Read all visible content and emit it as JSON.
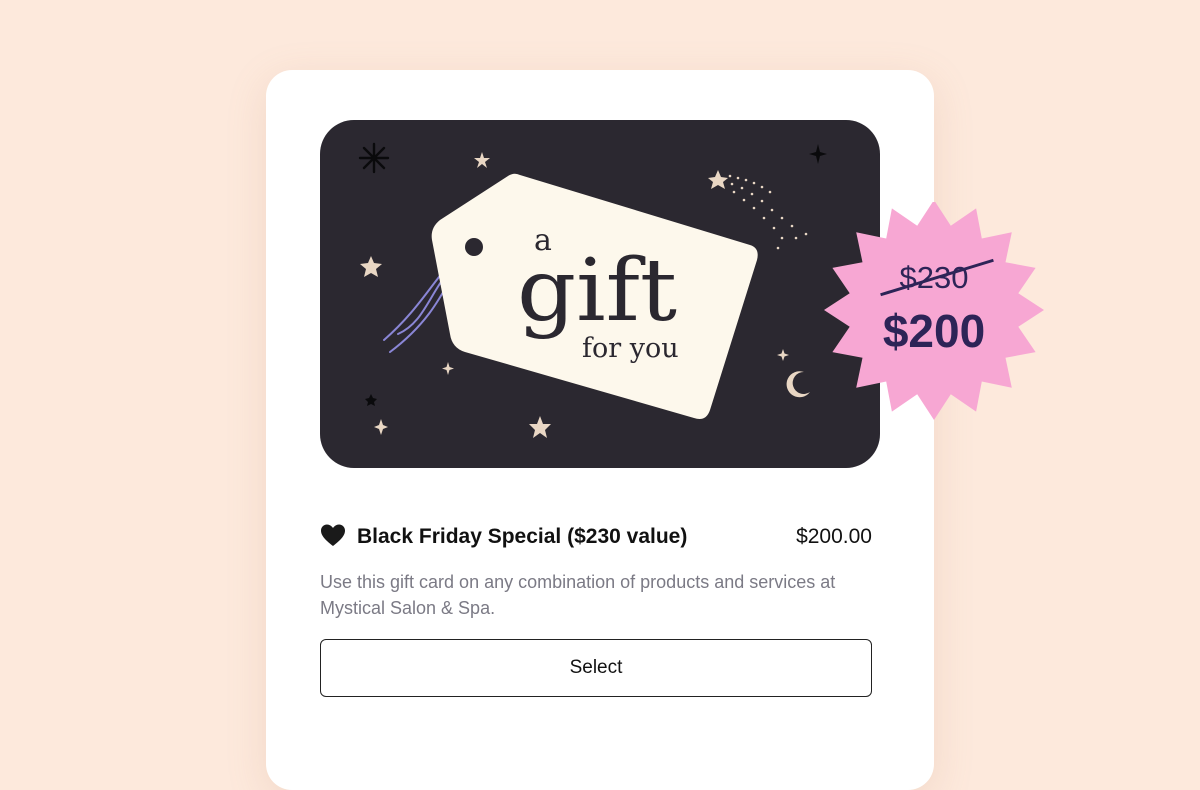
{
  "gift_card": {
    "art_text": {
      "line1": "a",
      "line2": "gift",
      "line3": "for you"
    },
    "colors": {
      "card_background": "#2b2830",
      "tag": "#fdf8ec",
      "stars": "#e9d7c4",
      "ribbon": "#8a86d6"
    }
  },
  "badge": {
    "old_price": "$230",
    "new_price": "$200",
    "colors": {
      "background": "#f7a7d3",
      "text": "#2d2457"
    }
  },
  "product": {
    "icon": "black-heart-icon",
    "title": "Black Friday Special ($230 value)",
    "price": "$200.00",
    "description": "Use this gift card on any combination of products and services at Mystical Salon & Spa."
  },
  "actions": {
    "select_label": "Select"
  }
}
